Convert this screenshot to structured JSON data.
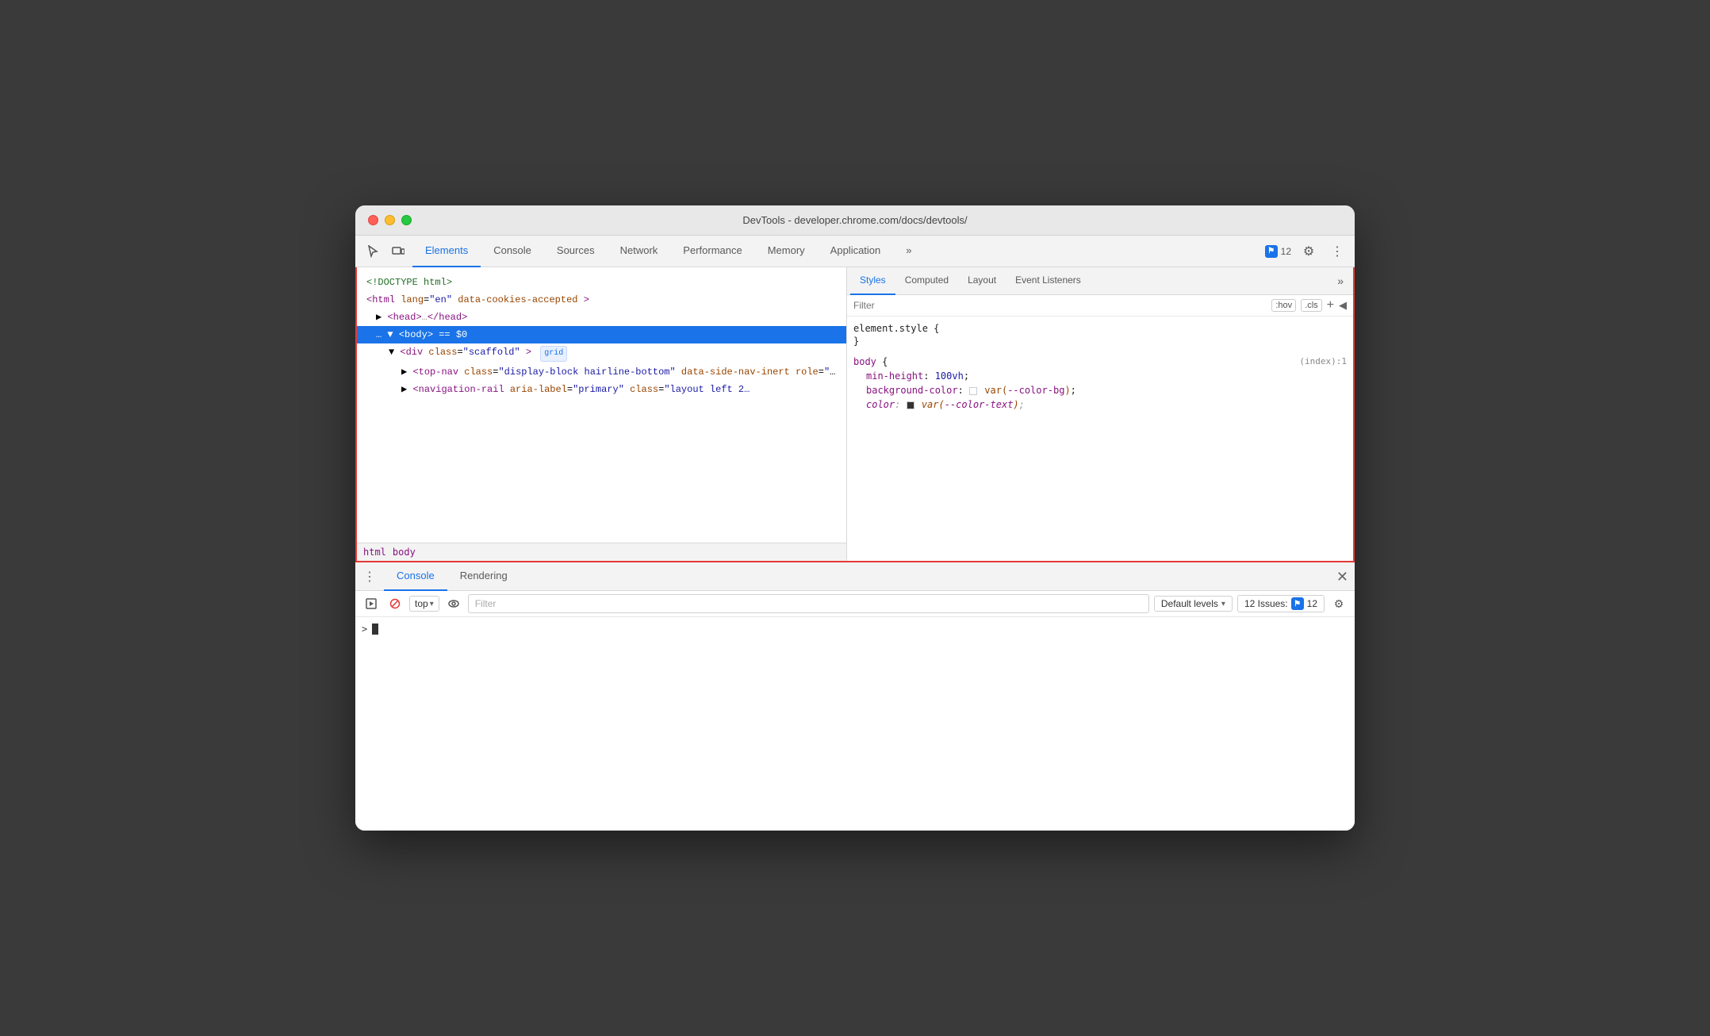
{
  "window": {
    "title": "DevTools - developer.chrome.com/docs/devtools/"
  },
  "toolbar": {
    "tabs": [
      {
        "label": "Elements",
        "active": true
      },
      {
        "label": "Console",
        "active": false
      },
      {
        "label": "Sources",
        "active": false
      },
      {
        "label": "Network",
        "active": false
      },
      {
        "label": "Performance",
        "active": false
      },
      {
        "label": "Memory",
        "active": false
      },
      {
        "label": "Application",
        "active": false
      }
    ],
    "more_label": "»",
    "issues_count": "12",
    "settings_label": "⚙"
  },
  "dom": {
    "lines": [
      {
        "text": "<!DOCTYPE html>",
        "indent": 0,
        "type": "comment"
      },
      {
        "text": "html_lang_en",
        "indent": 0
      },
      {
        "text": "head",
        "indent": 1
      },
      {
        "text": "body_selected",
        "indent": 1
      },
      {
        "text": "div_scaffold",
        "indent": 2
      },
      {
        "text": "top_nav",
        "indent": 3
      },
      {
        "text": "nav_rail",
        "indent": 3
      }
    ],
    "doctype": "<!DOCTYPE html>",
    "html_open": "<html lang=\"en\" data-cookies-accepted>",
    "head": "▶ <head>…</head>",
    "body_marker": "… ▼ <body> == $0",
    "body_indent": "▼ <div class=\"scaffold\"> ",
    "badge_grid": "grid",
    "top_nav_text": "▶ <top-nav class=\"display-block hairline-bottom\" data-side-nav-inert role=\"banner\">…</top-nav>",
    "nav_rail_text": "▶ <navigation-rail aria-label=\"primary\" class=\"layout left 2..."
  },
  "breadcrumb": {
    "items": [
      "html",
      "body"
    ]
  },
  "styles": {
    "tabs": [
      "Styles",
      "Computed",
      "Layout",
      "Event Listeners"
    ],
    "active_tab": "Styles",
    "more_label": "»",
    "filter_placeholder": "Filter",
    "hov_label": ":hov",
    "cls_label": ".cls",
    "element_style_header": "element.style {",
    "element_style_close": "}",
    "body_rule_header": "body {",
    "body_rule_source": "(index):1",
    "body_min_height": "min-height: 100vh;",
    "body_bg_color": "background-color:",
    "body_bg_var": "var(--color-bg);",
    "body_color": "color:",
    "body_color_var": "var(--color-text);"
  },
  "console": {
    "tabs": [
      "Console",
      "Rendering"
    ],
    "active_tab": "Console",
    "top_selector": "top",
    "filter_placeholder": "Filter",
    "default_levels": "Default levels",
    "issues_label": "12 Issues:",
    "issues_count": "12",
    "prompt_symbol": ">",
    "close_symbol": "✕"
  }
}
